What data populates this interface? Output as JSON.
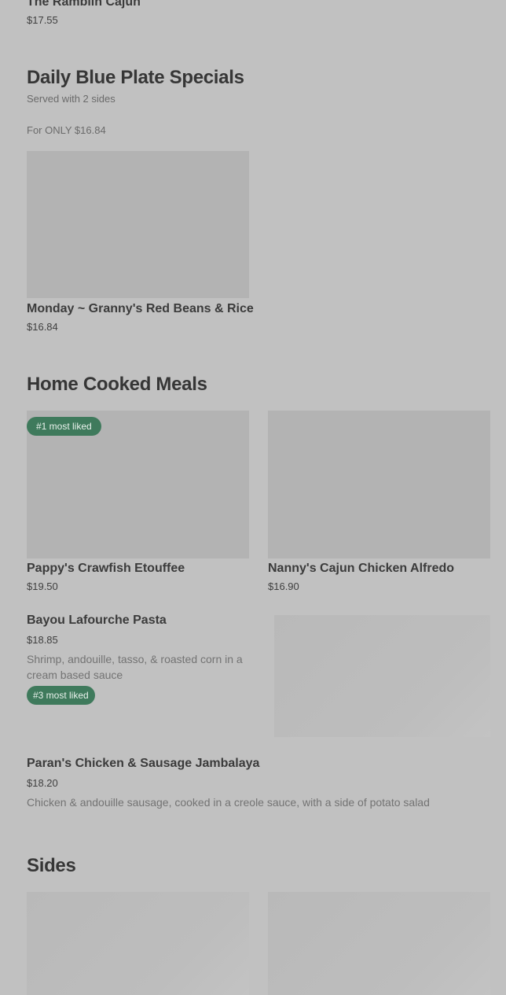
{
  "top_item": {
    "name": "The Ramblin Cajun",
    "price": "$17.55"
  },
  "specials": {
    "title": "Daily Blue Plate Specials",
    "subtitle1": "Served with 2 sides",
    "subtitle2": "For ONLY $16.84",
    "items": [
      {
        "name": "Monday ~ Granny's Red Beans & Rice",
        "price": "$16.84"
      }
    ]
  },
  "home_cooked": {
    "title": "Home Cooked Meals",
    "items": [
      {
        "name": "Pappy's Crawfish Etouffee",
        "price": "$19.50",
        "badge": "#1 most liked"
      },
      {
        "name": "Nanny's Cajun Chicken Alfredo",
        "price": "$16.90"
      },
      {
        "name": "Bayou Lafourche Pasta",
        "price": "$18.85",
        "description": "Shrimp, andouille, tasso, & roasted corn in a cream based sauce",
        "badge": "#3 most liked"
      },
      {
        "name": "Paran's Chicken & Sausage Jambalaya",
        "price": "$18.20",
        "description": "Chicken & andouille sausage, cooked in a creole sauce, with a side of potato salad"
      }
    ]
  },
  "sides": {
    "title": "Sides"
  },
  "colors": {
    "background": "#c1c1c1",
    "badge": "#3f7a5c",
    "image_placeholder": "#b3b3b3"
  }
}
